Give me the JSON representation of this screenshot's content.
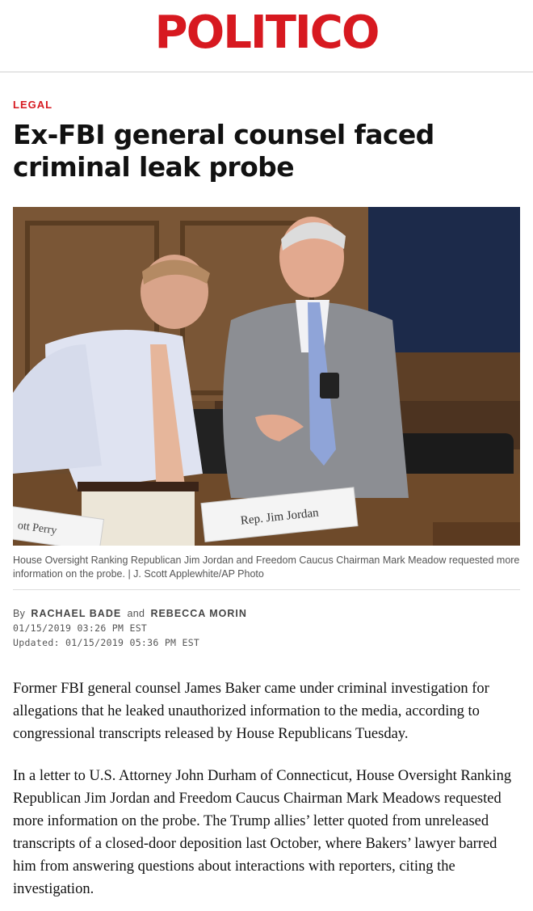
{
  "masthead": {
    "logo_text": "POLITICO"
  },
  "article": {
    "section": "LEGAL",
    "headline": "Ex-FBI general counsel faced criminal leak probe",
    "photo": {
      "caption": "House Oversight Ranking Republican Jim Jordan and Freedom Caucus Chairman Mark Meadow requested more information on the probe. | J. Scott Applewhite/AP Photo",
      "nameplate_main": "Rep. Jim Jordan",
      "nameplate_side": "ott Perry"
    },
    "byline": {
      "by": "By",
      "author1": "RACHAEL BADE",
      "and": "and",
      "author2": "REBECCA MORIN",
      "published": "01/15/2019 03:26 PM EST",
      "updated": "Updated: 01/15/2019 05:36 PM EST"
    },
    "paragraphs": [
      "Former FBI general counsel James Baker came under criminal investigation for allegations that he leaked unauthorized information to the media, according to congressional transcripts released by House Republicans Tuesday.",
      "In a letter to U.S. Attorney John Durham of Connecticut, House Oversight Ranking Republican Jim Jordan and Freedom Caucus Chairman Mark Meadows requested more information on the probe. The Trump allies’ letter quoted from unreleased transcripts of a closed-door deposition last October, where Bakers’ lawyer barred him from answering questions about interactions with reporters, citing the investigation."
    ]
  },
  "colors": {
    "brand_red": "#d71920",
    "caption_gray": "#555555"
  }
}
